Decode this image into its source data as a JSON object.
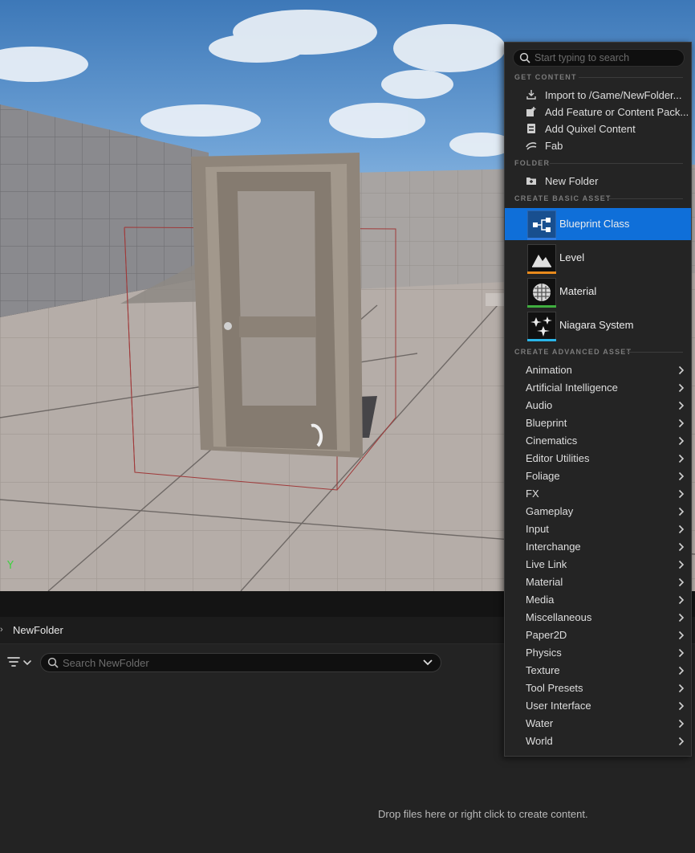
{
  "viewport": {
    "axis_label": "Y"
  },
  "content_browser": {
    "path": "NewFolder",
    "search_placeholder": "Search NewFolder",
    "drop_hint": "Drop files here or right click to create content."
  },
  "menu": {
    "search_placeholder": "Start typing to search",
    "sections": {
      "get_content": "GET CONTENT",
      "folder": "FOLDER",
      "basic": "CREATE BASIC ASSET",
      "advanced": "CREATE ADVANCED ASSET"
    },
    "get_content": [
      {
        "label": "Import to /Game/NewFolder...",
        "icon": "import-icon"
      },
      {
        "label": "Add Feature or Content Pack...",
        "icon": "content-pack-icon"
      },
      {
        "label": "Add Quixel Content",
        "icon": "quixel-icon"
      },
      {
        "label": "Fab",
        "icon": "fab-icon"
      }
    ],
    "folder_items": [
      {
        "label": "New Folder",
        "icon": "new-folder-icon"
      }
    ],
    "basic_assets": [
      {
        "label": "Blueprint Class",
        "icon": "blueprint-class-icon",
        "color": "#2f7be0",
        "selected": true
      },
      {
        "label": "Level",
        "icon": "level-icon",
        "color": "#e88a1c",
        "selected": false
      },
      {
        "label": "Material",
        "icon": "material-icon",
        "color": "#3fae3f",
        "selected": false
      },
      {
        "label": "Niagara System",
        "icon": "niagara-icon",
        "color": "#2ab5e8",
        "selected": false
      }
    ],
    "advanced_assets": [
      "Animation",
      "Artificial Intelligence",
      "Audio",
      "Blueprint",
      "Cinematics",
      "Editor Utilities",
      "Foliage",
      "FX",
      "Gameplay",
      "Input",
      "Interchange",
      "Live Link",
      "Material",
      "Media",
      "Miscellaneous",
      "Paper2D",
      "Physics",
      "Texture",
      "Tool Presets",
      "User Interface",
      "Water",
      "World"
    ]
  },
  "colors": {
    "accent": "#0f6fd9",
    "menu_bg": "#242424"
  }
}
